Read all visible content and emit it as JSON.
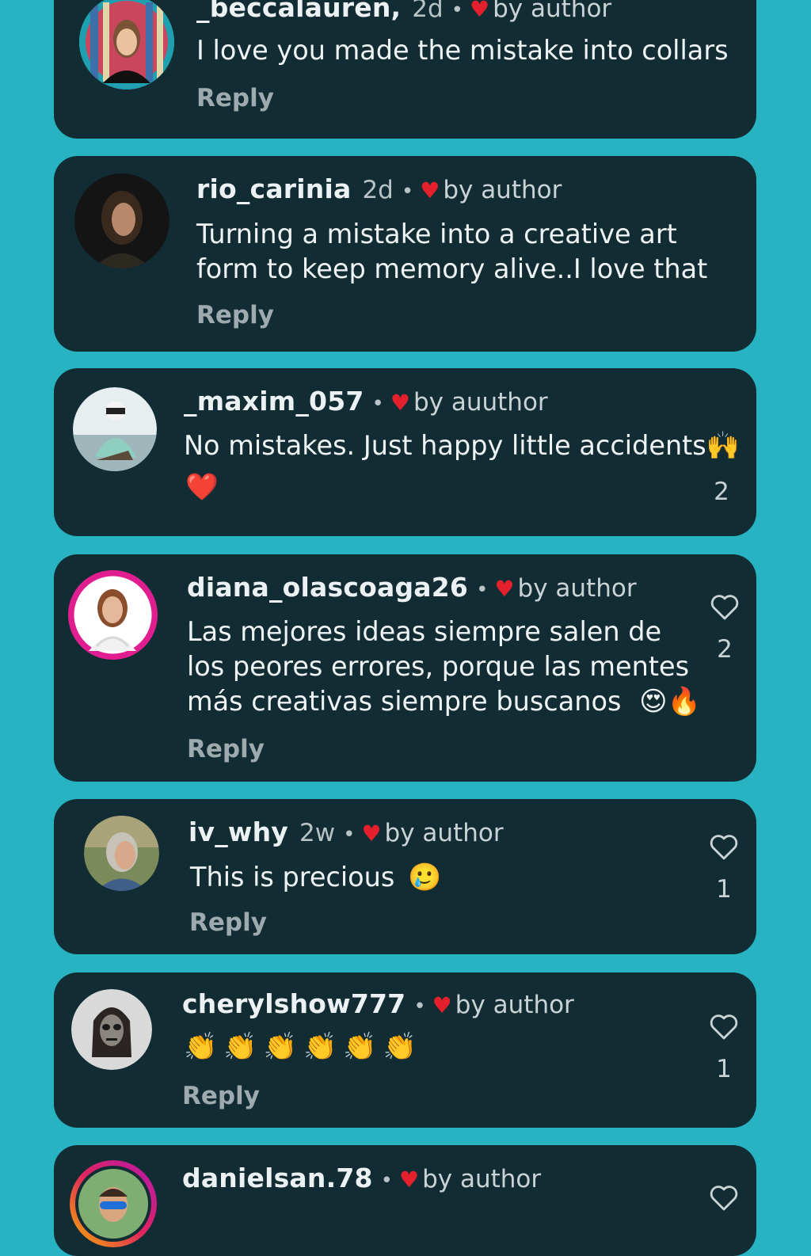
{
  "colors": {
    "background": "#27b3c2",
    "card": "#122c33",
    "author_heart": "#e5202d",
    "story_ring_teal": "#27b3c2",
    "story_ring_pink": "#e01e8f"
  },
  "author_badge": "by author",
  "reply_label": "Reply",
  "comments": [
    {
      "username": "_beccalauren,",
      "time": "2d",
      "badge": "by author",
      "lines": [
        "I love you made the mistake into collars"
      ],
      "reply": "Reply",
      "likes": null,
      "avatar_ring": "teal"
    },
    {
      "username": "rio_carinia",
      "time": "2d",
      "badge": "by author",
      "lines": [
        "Turning a mistake into a creative art",
        "form to keep memory alive..I love that"
      ],
      "reply": "Reply",
      "likes": null,
      "avatar_ring": "none"
    },
    {
      "username": "_maxim_057",
      "time": "",
      "badge": "by auuthor",
      "lines": [
        "No mistakes. Just happy little accidents"
      ],
      "line_emoji": "🙌",
      "second_line_emoji": "❤️",
      "reply": "",
      "likes": "2",
      "avatar_ring": "none"
    },
    {
      "username": "diana_olascoaga26",
      "time": "",
      "badge": "by author",
      "lines": [
        "Las mejores ideas siempre salen de",
        "los peores errores, porque las mentes",
        "más creativas siempre buscanos"
      ],
      "line_emoji": "😍🔥",
      "reply": "Reply",
      "likes": "2",
      "avatar_ring": "pink"
    },
    {
      "username": "iv_why",
      "time": "2w",
      "badge": "by author",
      "lines": [
        "This is precious"
      ],
      "line_emoji": "🥲",
      "reply": "Reply",
      "likes": "1",
      "avatar_ring": "none"
    },
    {
      "username": "cherylshow777",
      "time": "",
      "badge": "by author",
      "lines": [
        ""
      ],
      "line_emoji": "👏👏👏👏👏👏",
      "reply": "Reply",
      "likes": "1",
      "avatar_ring": "none"
    },
    {
      "username": "danielsan.78",
      "time": "",
      "badge": "by author",
      "lines": [],
      "reply": "",
      "likes": null,
      "avatar_ring": "rainbow"
    }
  ]
}
